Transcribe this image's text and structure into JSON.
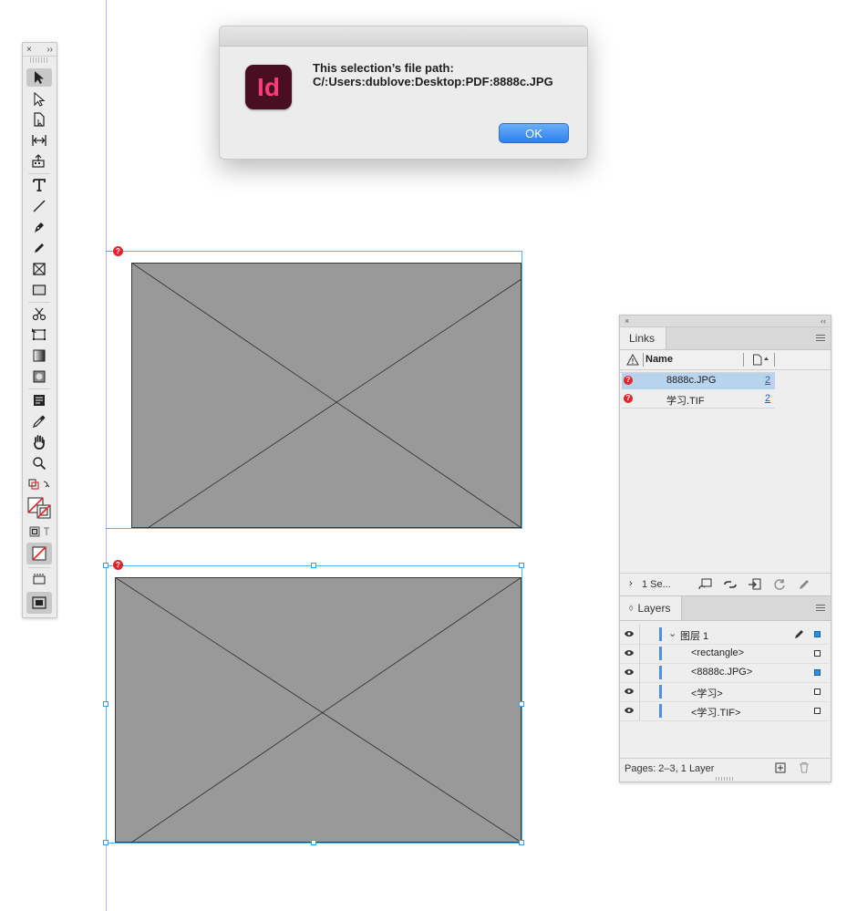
{
  "dialog": {
    "app_icon_text": "Id",
    "line1": "This selection’s file path:",
    "line2": "C/:Users:dublove:Desktop:PDF:8888c.JPG",
    "ok_label": "OK"
  },
  "toolbar": {
    "close_glyph": "×",
    "collapse_glyph": "››"
  },
  "frames": {
    "missing_glyph": "?"
  },
  "links_panel": {
    "close_glyph": "×",
    "collapse_glyph": "‹‹",
    "tab_label": "Links",
    "col_name": "Name",
    "rows": [
      {
        "name": "8888c.JPG",
        "page": "2"
      },
      {
        "name": "学习.TIF",
        "page": "2"
      }
    ],
    "footer_text": "1 Se..."
  },
  "layers_panel": {
    "tab_label": "Layers",
    "rows": [
      {
        "label": "图层 1"
      },
      {
        "label": "<rectangle>"
      },
      {
        "label": "<8888c.JPG>"
      },
      {
        "label": "<学习>"
      },
      {
        "label": "<学习.TIF>"
      }
    ],
    "footer_text": "Pages: 2–3, 1 Layer"
  },
  "colors": {
    "selection": "#5ab0e6",
    "frame_fill": "#999999",
    "missing_link": "#e0252b",
    "layer_color": "#4c8ee8"
  }
}
